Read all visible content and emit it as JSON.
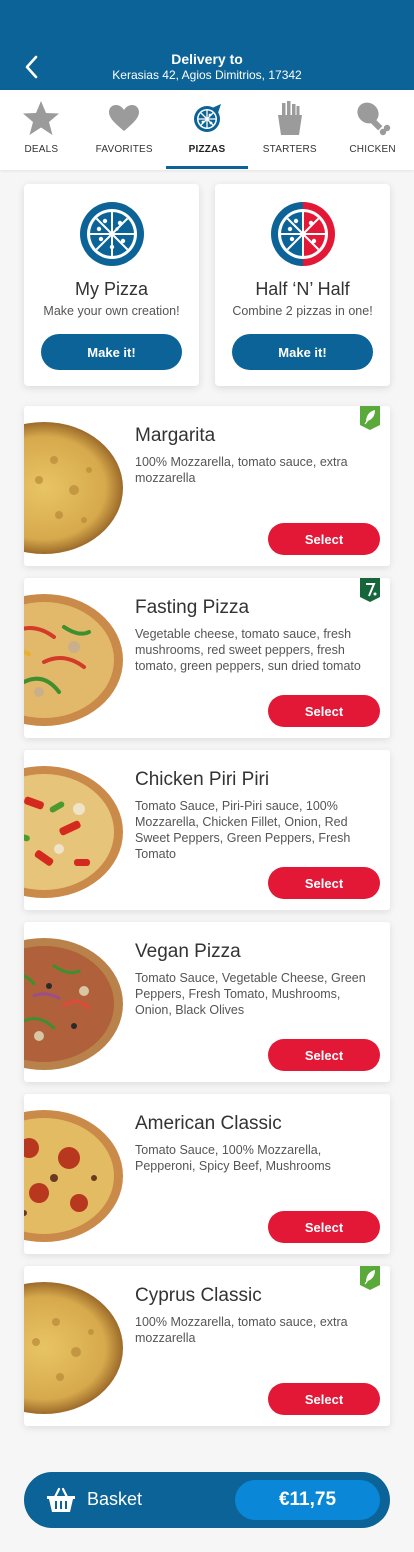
{
  "header": {
    "title": "Delivery to",
    "address": "Kerasias 42, Agios Dimitrios, 17342"
  },
  "tabs": [
    {
      "label": "DEALS",
      "icon": "star-icon"
    },
    {
      "label": "FAVORITES",
      "icon": "heart-icon"
    },
    {
      "label": "PIZZAS",
      "icon": "pizza-icon",
      "active": true
    },
    {
      "label": "STARTERS",
      "icon": "fries-icon"
    },
    {
      "label": "CHICKEN",
      "icon": "drumstick-icon"
    }
  ],
  "create": [
    {
      "title": "My Pizza",
      "subtitle": "Make your own creation!",
      "button": "Make it!"
    },
    {
      "title": "Half ‘N’ Half",
      "subtitle": "Combine 2 pizzas in one!",
      "button": "Make it!"
    }
  ],
  "pizzas": [
    {
      "name": "Margarita",
      "description": "100% Mozzarella, tomato sauce, extra mozzarella",
      "button": "Select",
      "badge": "vegetarian-leaf-icon"
    },
    {
      "name": "Fasting Pizza",
      "description": "Vegetable cheese, tomato sauce, fresh mushrooms, red sweet peppers, fresh tomato, green peppers, sun dried tomato",
      "button": "Select",
      "badge": "fasting-icon"
    },
    {
      "name": "Chicken Piri Piri",
      "description": "Tomato Sauce, Piri-Piri sauce, 100% Mozzarella, Chicken Fillet, Onion, Red Sweet Peppers, Green Peppers, Fresh Tomato",
      "button": "Select"
    },
    {
      "name": "Vegan Pizza",
      "description": "Tomato Sauce, Vegetable Cheese, Green Peppers, Fresh Tomato, Mushrooms, Onion, Black Olives",
      "button": "Select"
    },
    {
      "name": "American Classic",
      "description": "Tomato Sauce, 100% Mozzarella, Pepperoni, Spicy Beef, Mushrooms",
      "button": "Select"
    },
    {
      "name": "Cyprus Classic",
      "description": "100% Mozzarella, tomato sauce, extra mozzarella",
      "button": "Select",
      "badge": "vegetarian-leaf-icon"
    }
  ],
  "basket": {
    "label": "Basket",
    "total": "€11,75"
  },
  "colors": {
    "brand_blue": "#0b6397",
    "select_red": "#e31837",
    "total_blue": "#0a87d6",
    "veg_green": "#5aaa3a",
    "fasting_green": "#16663a"
  }
}
